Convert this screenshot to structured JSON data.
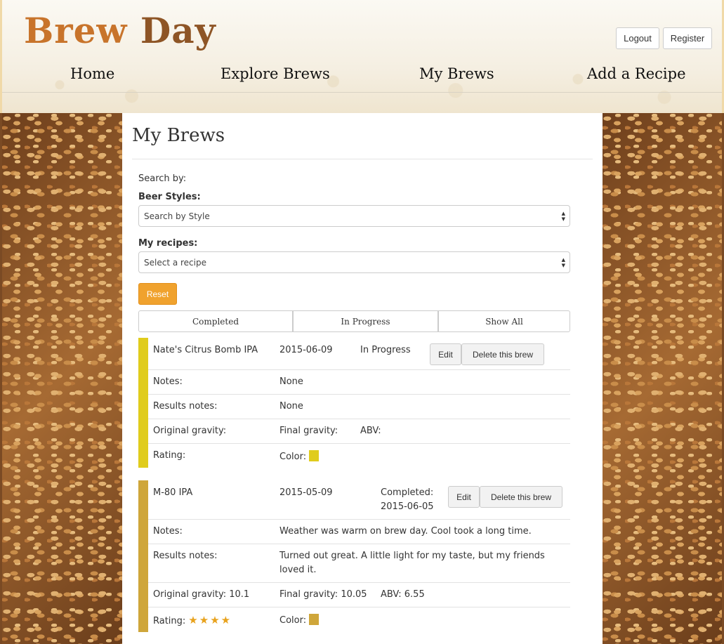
{
  "header": {
    "logo_part1": "Brew",
    "logo_part2": "Day",
    "logout_label": "Logout",
    "register_label": "Register",
    "nav": {
      "home": "Home",
      "explore": "Explore Brews",
      "my_brews": "My Brews",
      "add_recipe": "Add a Recipe"
    }
  },
  "main": {
    "title": "My Brews",
    "search_by": "Search by:",
    "beer_styles_label": "Beer Styles:",
    "style_select_value": "Search by Style",
    "my_recipes_label": "My recipes:",
    "recipe_select_value": "Select a recipe",
    "reset_label": "Reset",
    "filters": {
      "completed": "Completed",
      "in_progress": "In Progress",
      "show_all": "Show All"
    }
  },
  "brews": [
    {
      "name": "Nate's Citrus Bomb IPA",
      "date": "2015-06-09",
      "status": "In Progress",
      "edit_label": "Edit",
      "delete_label": "Delete this brew",
      "notes_label": "Notes:",
      "notes": "None",
      "results_label": "Results notes:",
      "results": "None",
      "og_label": "Original gravity:",
      "og": "",
      "fg_label": "Final gravity:",
      "fg": "",
      "abv_label": "ABV:",
      "abv": "",
      "rating_label": "Rating:",
      "rating": 0,
      "color_label": "Color:",
      "color": "#e0cc1c"
    },
    {
      "name": "M-80 IPA",
      "date": "2015-05-09",
      "status": "Completed:",
      "completed_date": "2015-06-05",
      "edit_label": "Edit",
      "delete_label": "Delete this brew",
      "notes_label": "Notes:",
      "notes": "Weather was warm on brew day. Cool took a long time.",
      "results_label": "Results notes:",
      "results": "Turned out great. A little light for my taste, but my friends loved it.",
      "og_label": "Original gravity:",
      "og": "10.1",
      "fg_label": "Final gravity:",
      "fg": "10.05",
      "abv_label": "ABV:",
      "abv": "6.55",
      "rating_label": "Rating:",
      "rating": 4,
      "stars": "★★★★",
      "color_label": "Color:",
      "color": "#cfa63a"
    }
  ]
}
